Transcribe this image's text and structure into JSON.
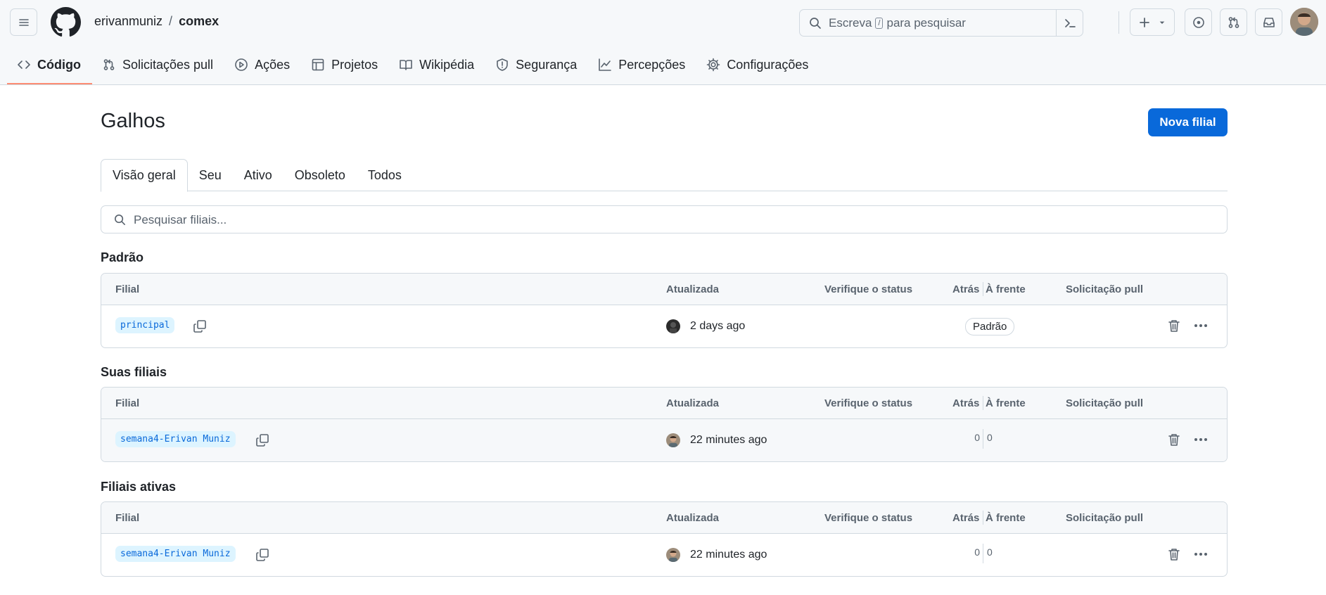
{
  "header": {
    "owner": "erivanmuniz",
    "separator": "/",
    "repo": "comex",
    "search_prefix": "Escreva",
    "search_key": "/",
    "search_suffix": "para pesquisar"
  },
  "nav": [
    {
      "label": "Código",
      "icon": "code-icon",
      "active": true
    },
    {
      "label": "Solicitações pull",
      "icon": "git-pull-request-icon"
    },
    {
      "label": "Ações",
      "icon": "play-icon"
    },
    {
      "label": "Projetos",
      "icon": "table-icon"
    },
    {
      "label": "Wikipédia",
      "icon": "book-icon"
    },
    {
      "label": "Segurança",
      "icon": "shield-icon"
    },
    {
      "label": "Percepções",
      "icon": "graph-icon"
    },
    {
      "label": "Configurações",
      "icon": "gear-icon"
    }
  ],
  "page": {
    "title": "Galhos",
    "new_branch_label": "Nova filial",
    "filter_placeholder": "Pesquisar filiais..."
  },
  "tabs": [
    "Visão geral",
    "Seu",
    "Ativo",
    "Obsoleto",
    "Todos"
  ],
  "columns": {
    "branch": "Filial",
    "updated": "Atualizada",
    "check": "Verifique o status",
    "behind": "Atrás",
    "ahead": "À frente",
    "pr": "Solicitação pull"
  },
  "sections": [
    {
      "title": "Padrão",
      "rows": [
        {
          "branch": "principal",
          "updated": "2 days ago",
          "badge": "Padrão"
        }
      ]
    },
    {
      "title": "Suas filiais",
      "rows": [
        {
          "branch": "semana4-Erivan Muniz",
          "updated": "22 minutes ago",
          "behind": "0",
          "ahead": "0"
        }
      ]
    },
    {
      "title": "Filiais ativas",
      "rows": [
        {
          "branch": "semana4-Erivan Muniz",
          "updated": "22 minutes ago",
          "behind": "0",
          "ahead": "0"
        }
      ]
    }
  ],
  "colors": {
    "accent": "#0969da",
    "branch_bg": "#ddf4ff",
    "nav_underline": "#fd8c73",
    "border": "#d1d9e0"
  }
}
